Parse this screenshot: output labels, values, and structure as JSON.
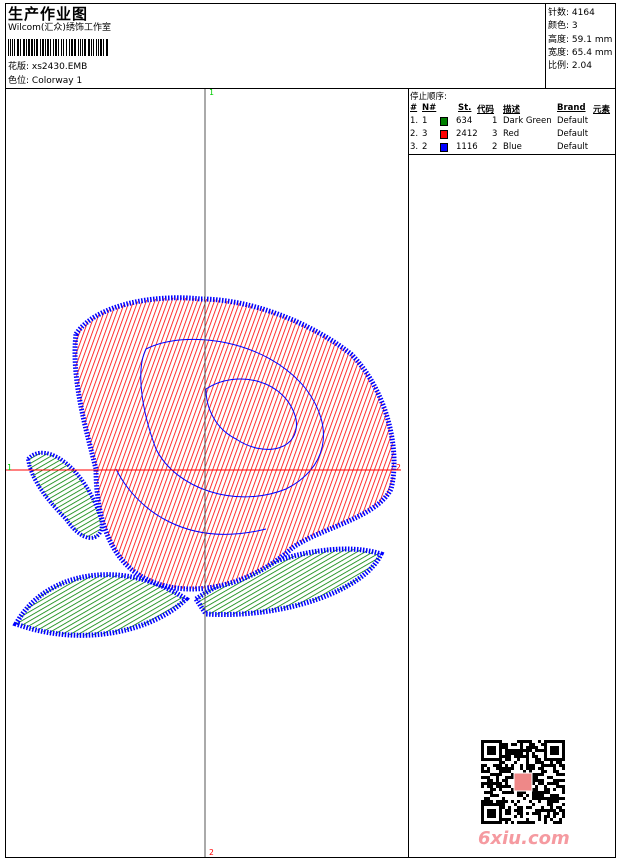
{
  "header": {
    "title": "生产作业图",
    "company": "Wilcom(汇众)绣饰工作室",
    "design_label": "花版:",
    "design_value": "xs2430.EMB",
    "colorway_label": "色位:",
    "colorway_value": "Colorway 1"
  },
  "info": [
    {
      "label": "针数:",
      "value": "4164"
    },
    {
      "label": "颜色:",
      "value": "3"
    },
    {
      "label": "高度:",
      "value": "59.1 mm"
    },
    {
      "label": "宽度:",
      "value": "65.4 mm"
    },
    {
      "label": "比例:",
      "value": "2.04"
    }
  ],
  "stop_sequence": {
    "title": "停止顺序:",
    "columns": [
      "#",
      "N#",
      "St.",
      "代码",
      "描述",
      "Brand",
      "元素"
    ],
    "rows": [
      {
        "idx": "1.",
        "n": "1",
        "color": "#008000",
        "st": "634",
        "code": "1",
        "desc": "Dark Green",
        "brand": "Default"
      },
      {
        "idx": "2.",
        "n": "3",
        "color": "#ff0000",
        "st": "2412",
        "code": "3",
        "desc": "Red",
        "brand": "Default"
      },
      {
        "idx": "3.",
        "n": "2",
        "color": "#0000ff",
        "st": "1116",
        "code": "2",
        "desc": "Blue",
        "brand": "Default"
      }
    ]
  },
  "markers": {
    "top": "1",
    "bottom": "2",
    "left": "1",
    "right": "2"
  },
  "watermark": "6xiu.com"
}
